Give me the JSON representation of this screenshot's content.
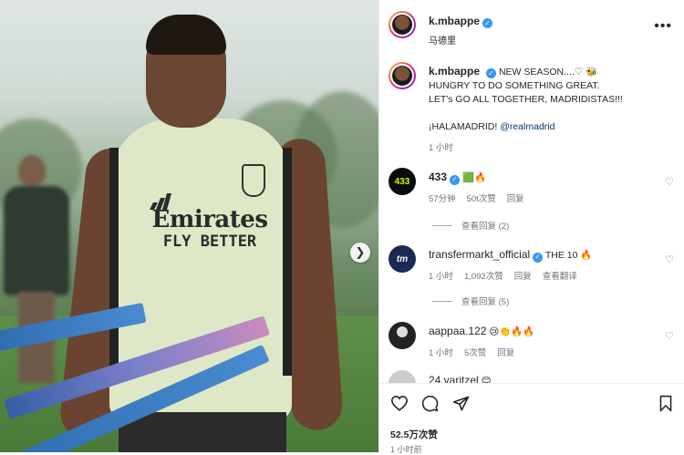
{
  "post": {
    "username": "k.mbappe",
    "location": "马德里",
    "caption_lines": [
      "NEW SEASON....♡ 🐝",
      "HUNGRY TO DO SOMETHING GREAT.",
      "LET's GO ALL TOGETHER, MADRIDISTAS!!!"
    ],
    "hashtag": "¡HALAMADRID!",
    "mention": "@realmadrid",
    "caption_time": "1 小时",
    "likes": "52.5万次赞",
    "time": "1 小时前"
  },
  "photo": {
    "sponsor_line1": "Emirates",
    "sponsor_line2": "FLY BETTER"
  },
  "comments": [
    {
      "username": "433",
      "text": "🟩🔥",
      "age": "57分钟",
      "likes": "50t次赞",
      "reply": "回复",
      "view_replies": "查看回复 (2)",
      "avatar_text": "433",
      "avatar_color": "#0b0b0b",
      "avatar_fg": "#c8ff00"
    },
    {
      "username": "transfermarkt_official",
      "text": "THE 10 🔥",
      "age": "1 小时",
      "likes": "1,092次赞",
      "reply": "回复",
      "translate": "查看翻译",
      "view_replies": "查看回复 (5)",
      "avatar_text": "tm",
      "avatar_color": "#1b2a52",
      "avatar_fg": "#ffffff"
    },
    {
      "username": "aappaa.122",
      "text": "😢👏🔥🔥",
      "age": "1 小时",
      "likes": "5次赞",
      "reply": "回复",
      "avatar_color": "#222222"
    },
    {
      "username": "24.varitzel",
      "text": "😊",
      "avatar_color": "#cccccc"
    }
  ],
  "colors": {
    "verified": "#3897f0",
    "link": "#00376b",
    "muted": "#737373"
  }
}
